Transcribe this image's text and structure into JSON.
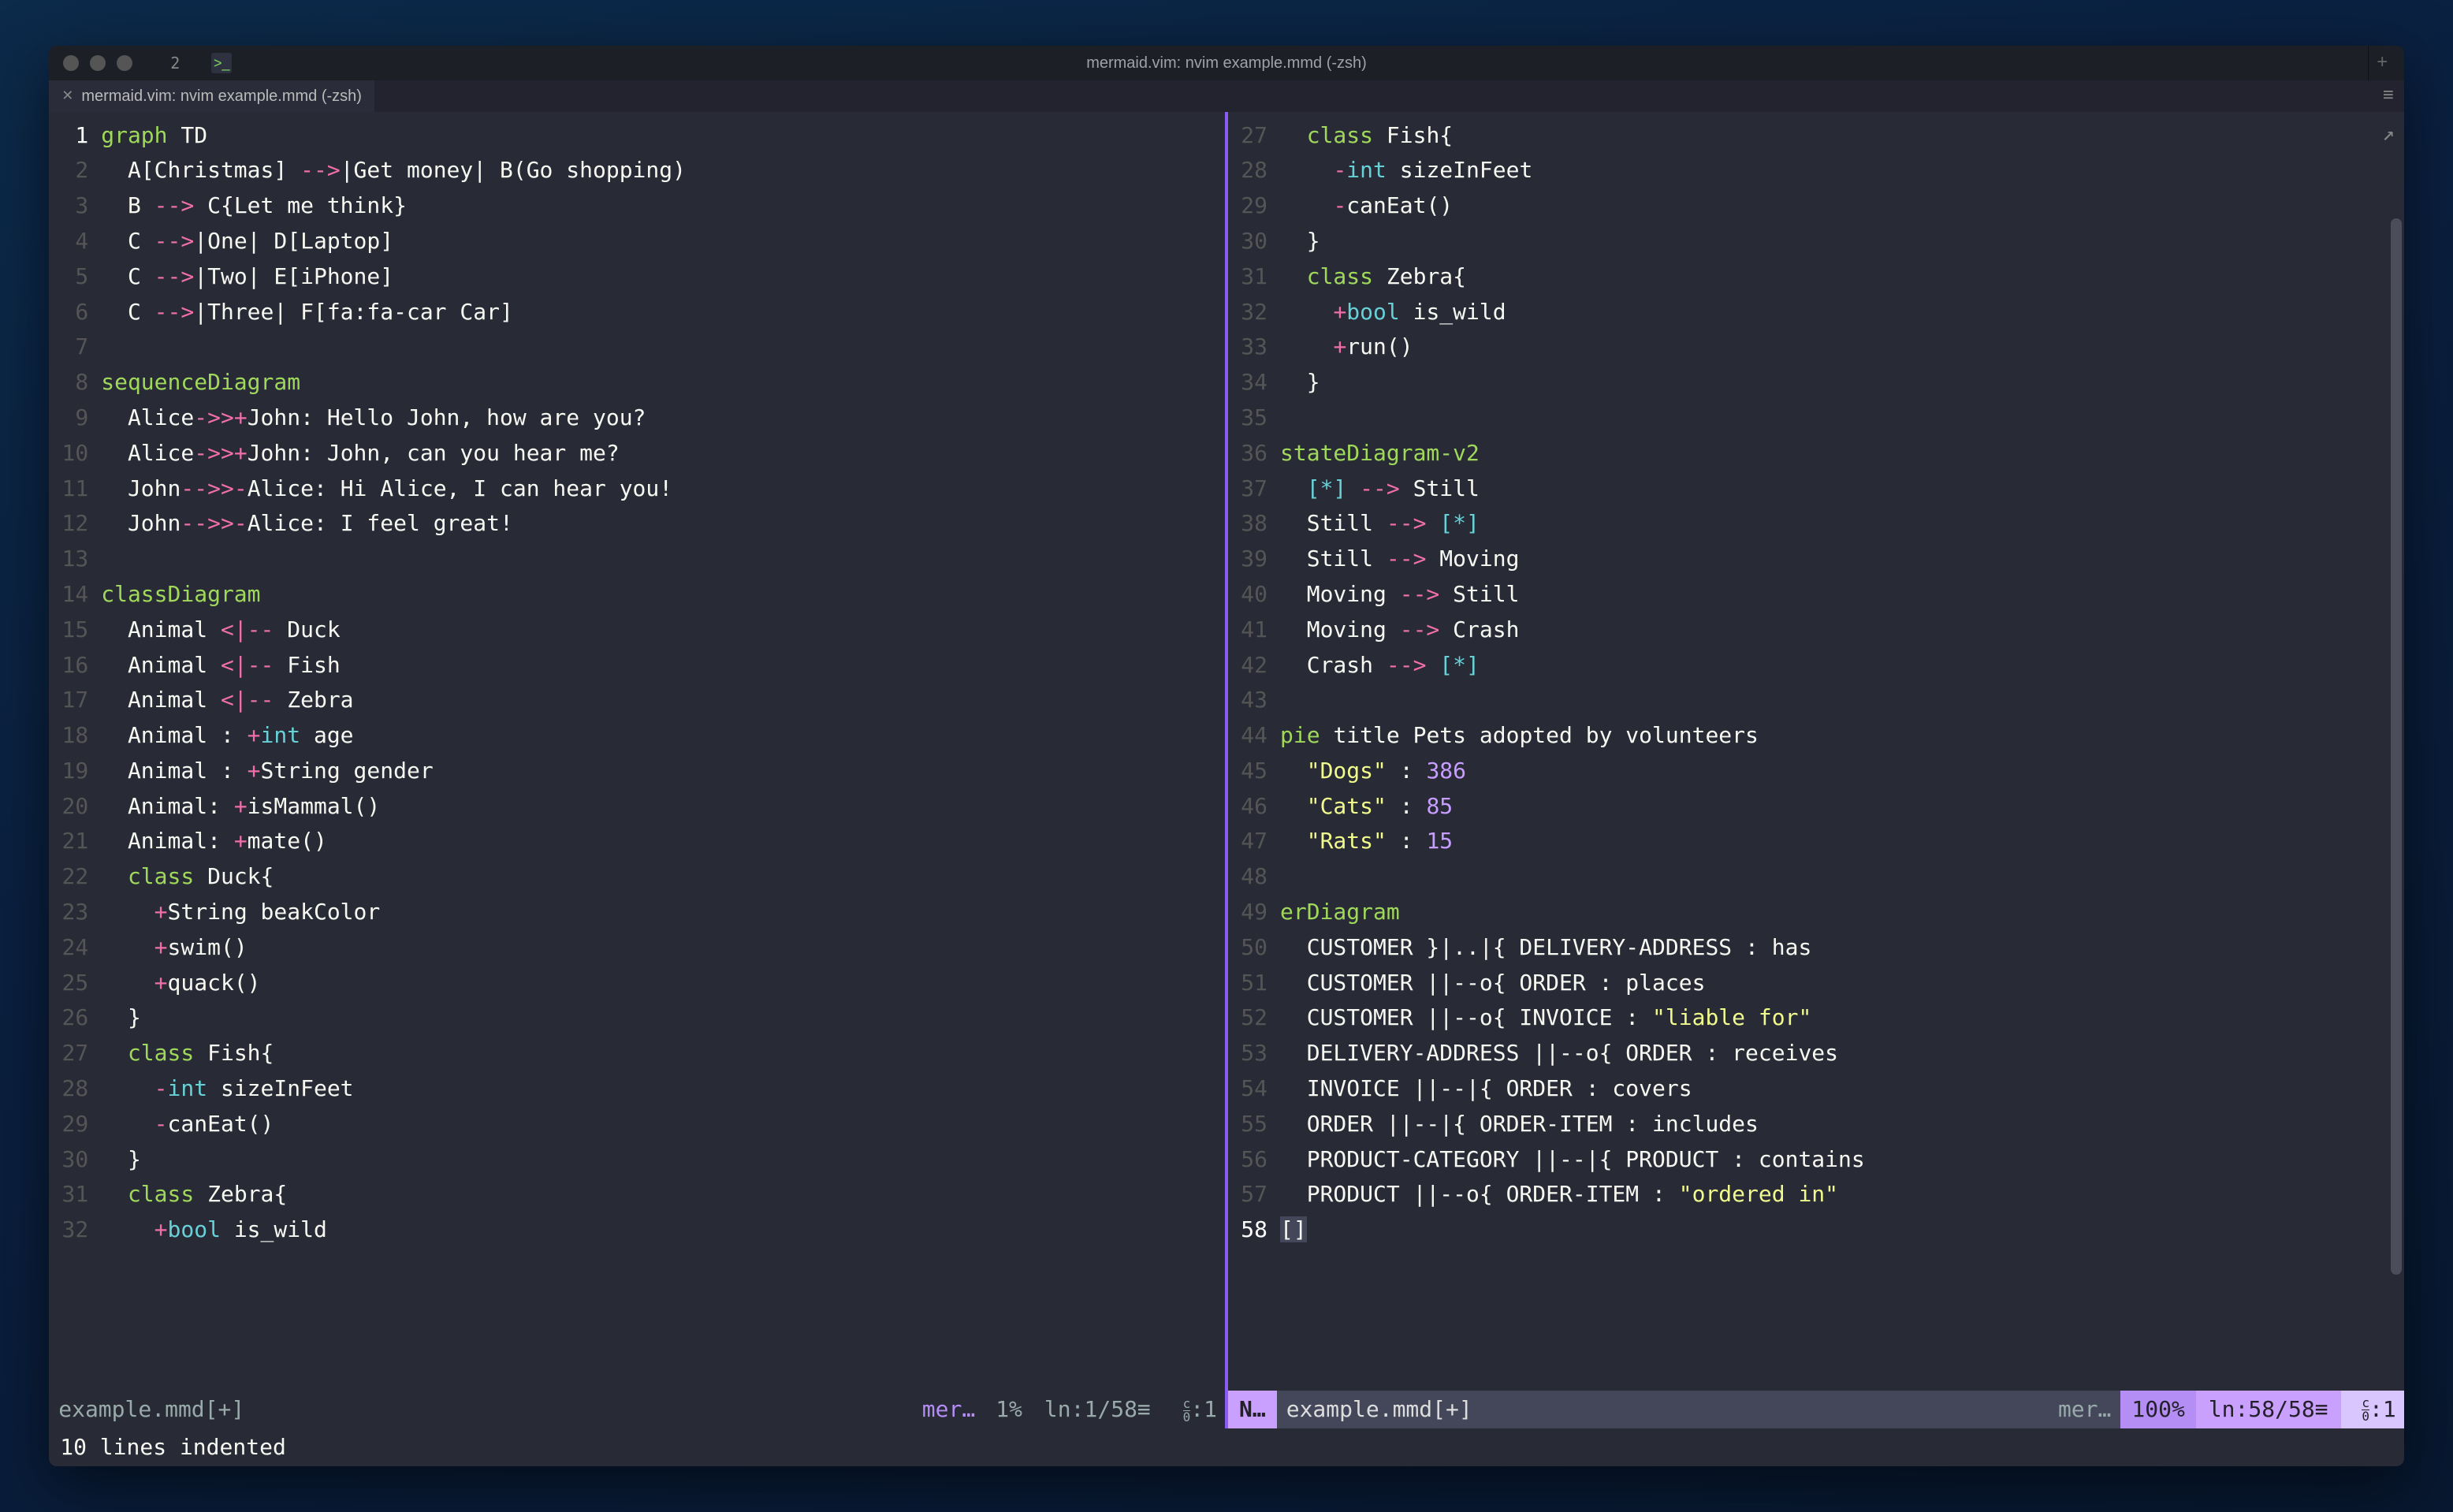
{
  "window": {
    "tab_number": "2",
    "title": "mermaid.vim: nvim example.mmd (-zsh)",
    "plus": "+"
  },
  "apptab": {
    "close": "✕",
    "label": "mermaid.vim: nvim example.mmd (-zsh)",
    "menu": "≡"
  },
  "share_icon": "↗",
  "left_pane": {
    "lines": [
      {
        "n": "1",
        "cur": true,
        "seg": [
          {
            "t": "graph ",
            "c": "kw"
          },
          {
            "t": "TD",
            "c": "white"
          }
        ]
      },
      {
        "n": "2",
        "seg": [
          {
            "t": "  A[Christmas] ",
            "c": "white"
          },
          {
            "t": "-->",
            "c": "op"
          },
          {
            "t": "|Get money| B(Go shopping)",
            "c": "white"
          }
        ]
      },
      {
        "n": "3",
        "seg": [
          {
            "t": "  B ",
            "c": "white"
          },
          {
            "t": "-->",
            "c": "op"
          },
          {
            "t": " C{Let me think}",
            "c": "white"
          }
        ]
      },
      {
        "n": "4",
        "seg": [
          {
            "t": "  C ",
            "c": "white"
          },
          {
            "t": "-->",
            "c": "op"
          },
          {
            "t": "|One| D[Laptop]",
            "c": "white"
          }
        ]
      },
      {
        "n": "5",
        "seg": [
          {
            "t": "  C ",
            "c": "white"
          },
          {
            "t": "-->",
            "c": "op"
          },
          {
            "t": "|Two| E[iPhone]",
            "c": "white"
          }
        ]
      },
      {
        "n": "6",
        "seg": [
          {
            "t": "  C ",
            "c": "white"
          },
          {
            "t": "-->",
            "c": "op"
          },
          {
            "t": "|Three| F[fa:fa-car Car]",
            "c": "white"
          }
        ]
      },
      {
        "n": "7",
        "seg": []
      },
      {
        "n": "8",
        "seg": [
          {
            "t": "sequenceDiagram",
            "c": "kw"
          }
        ]
      },
      {
        "n": "9",
        "seg": [
          {
            "t": "  Alice",
            "c": "white"
          },
          {
            "t": "->>+",
            "c": "op"
          },
          {
            "t": "John: Hello John, how are you?",
            "c": "white"
          }
        ]
      },
      {
        "n": "10",
        "seg": [
          {
            "t": "  Alice",
            "c": "white"
          },
          {
            "t": "->>+",
            "c": "op"
          },
          {
            "t": "John: John, can you hear me?",
            "c": "white"
          }
        ]
      },
      {
        "n": "11",
        "seg": [
          {
            "t": "  John",
            "c": "white"
          },
          {
            "t": "-->>-",
            "c": "op"
          },
          {
            "t": "Alice: Hi Alice, I can hear you!",
            "c": "white"
          }
        ]
      },
      {
        "n": "12",
        "seg": [
          {
            "t": "  John",
            "c": "white"
          },
          {
            "t": "-->>-",
            "c": "op"
          },
          {
            "t": "Alice: I feel great!",
            "c": "white"
          }
        ]
      },
      {
        "n": "13",
        "seg": []
      },
      {
        "n": "14",
        "seg": [
          {
            "t": "classDiagram",
            "c": "kw"
          }
        ]
      },
      {
        "n": "15",
        "seg": [
          {
            "t": "  Animal ",
            "c": "white"
          },
          {
            "t": "<|--",
            "c": "op"
          },
          {
            "t": " Duck",
            "c": "white"
          }
        ]
      },
      {
        "n": "16",
        "seg": [
          {
            "t": "  Animal ",
            "c": "white"
          },
          {
            "t": "<|--",
            "c": "op"
          },
          {
            "t": " Fish",
            "c": "white"
          }
        ]
      },
      {
        "n": "17",
        "seg": [
          {
            "t": "  Animal ",
            "c": "white"
          },
          {
            "t": "<|--",
            "c": "op"
          },
          {
            "t": " Zebra",
            "c": "white"
          }
        ]
      },
      {
        "n": "18",
        "seg": [
          {
            "t": "  Animal : ",
            "c": "white"
          },
          {
            "t": "+",
            "c": "vis"
          },
          {
            "t": "int",
            "c": "ty"
          },
          {
            "t": " age",
            "c": "white"
          }
        ]
      },
      {
        "n": "19",
        "seg": [
          {
            "t": "  Animal : ",
            "c": "white"
          },
          {
            "t": "+",
            "c": "vis"
          },
          {
            "t": "String gender",
            "c": "white"
          }
        ]
      },
      {
        "n": "20",
        "seg": [
          {
            "t": "  Animal: ",
            "c": "white"
          },
          {
            "t": "+",
            "c": "vis"
          },
          {
            "t": "isMammal()",
            "c": "white"
          }
        ]
      },
      {
        "n": "21",
        "seg": [
          {
            "t": "  Animal: ",
            "c": "white"
          },
          {
            "t": "+",
            "c": "vis"
          },
          {
            "t": "mate()",
            "c": "white"
          }
        ]
      },
      {
        "n": "22",
        "seg": [
          {
            "t": "  ",
            "c": "white"
          },
          {
            "t": "class ",
            "c": "kw"
          },
          {
            "t": "Duck{",
            "c": "white"
          }
        ]
      },
      {
        "n": "23",
        "seg": [
          {
            "t": "    ",
            "c": "white"
          },
          {
            "t": "+",
            "c": "vis"
          },
          {
            "t": "String beakColor",
            "c": "white"
          }
        ]
      },
      {
        "n": "24",
        "seg": [
          {
            "t": "    ",
            "c": "white"
          },
          {
            "t": "+",
            "c": "vis"
          },
          {
            "t": "swim()",
            "c": "white"
          }
        ]
      },
      {
        "n": "25",
        "seg": [
          {
            "t": "    ",
            "c": "white"
          },
          {
            "t": "+",
            "c": "vis"
          },
          {
            "t": "quack()",
            "c": "white"
          }
        ]
      },
      {
        "n": "26",
        "seg": [
          {
            "t": "  }",
            "c": "white"
          }
        ]
      },
      {
        "n": "27",
        "seg": [
          {
            "t": "  ",
            "c": "white"
          },
          {
            "t": "class ",
            "c": "kw"
          },
          {
            "t": "Fish{",
            "c": "white"
          }
        ]
      },
      {
        "n": "28",
        "seg": [
          {
            "t": "    ",
            "c": "white"
          },
          {
            "t": "-",
            "c": "vis"
          },
          {
            "t": "int",
            "c": "ty"
          },
          {
            "t": " sizeInFeet",
            "c": "white"
          }
        ]
      },
      {
        "n": "29",
        "seg": [
          {
            "t": "    ",
            "c": "white"
          },
          {
            "t": "-",
            "c": "vis"
          },
          {
            "t": "canEat()",
            "c": "white"
          }
        ]
      },
      {
        "n": "30",
        "seg": [
          {
            "t": "  }",
            "c": "white"
          }
        ]
      },
      {
        "n": "31",
        "seg": [
          {
            "t": "  ",
            "c": "white"
          },
          {
            "t": "class ",
            "c": "kw"
          },
          {
            "t": "Zebra{",
            "c": "white"
          }
        ]
      },
      {
        "n": "32",
        "seg": [
          {
            "t": "    ",
            "c": "white"
          },
          {
            "t": "+",
            "c": "vis"
          },
          {
            "t": "bool",
            "c": "ty"
          },
          {
            "t": " is_wild",
            "c": "white"
          }
        ]
      }
    ],
    "status": {
      "filename": "example.mmd[+]",
      "filetype": "mer…",
      "percent": "1%",
      "lineinfo": "ln:1/58≡",
      "colinfo": ":1"
    }
  },
  "right_pane": {
    "lines": [
      {
        "n": "27",
        "seg": [
          {
            "t": "  ",
            "c": "white"
          },
          {
            "t": "class ",
            "c": "kw"
          },
          {
            "t": "Fish{",
            "c": "white"
          }
        ]
      },
      {
        "n": "28",
        "seg": [
          {
            "t": "    ",
            "c": "white"
          },
          {
            "t": "-",
            "c": "vis"
          },
          {
            "t": "int",
            "c": "ty"
          },
          {
            "t": " sizeInFeet",
            "c": "white"
          }
        ]
      },
      {
        "n": "29",
        "seg": [
          {
            "t": "    ",
            "c": "white"
          },
          {
            "t": "-",
            "c": "vis"
          },
          {
            "t": "canEat()",
            "c": "white"
          }
        ]
      },
      {
        "n": "30",
        "seg": [
          {
            "t": "  }",
            "c": "white"
          }
        ]
      },
      {
        "n": "31",
        "seg": [
          {
            "t": "  ",
            "c": "white"
          },
          {
            "t": "class ",
            "c": "kw"
          },
          {
            "t": "Zebra{",
            "c": "white"
          }
        ]
      },
      {
        "n": "32",
        "seg": [
          {
            "t": "    ",
            "c": "white"
          },
          {
            "t": "+",
            "c": "vis"
          },
          {
            "t": "bool",
            "c": "ty"
          },
          {
            "t": " is_wild",
            "c": "white"
          }
        ]
      },
      {
        "n": "33",
        "seg": [
          {
            "t": "    ",
            "c": "white"
          },
          {
            "t": "+",
            "c": "vis"
          },
          {
            "t": "run()",
            "c": "white"
          }
        ]
      },
      {
        "n": "34",
        "seg": [
          {
            "t": "  }",
            "c": "white"
          }
        ]
      },
      {
        "n": "35",
        "seg": []
      },
      {
        "n": "36",
        "seg": [
          {
            "t": "stateDiagram-v2",
            "c": "kw"
          }
        ]
      },
      {
        "n": "37",
        "seg": [
          {
            "t": "  ",
            "c": "white"
          },
          {
            "t": "[*]",
            "c": "ty"
          },
          {
            "t": " ",
            "c": "white"
          },
          {
            "t": "-->",
            "c": "op"
          },
          {
            "t": " Still",
            "c": "white"
          }
        ]
      },
      {
        "n": "38",
        "seg": [
          {
            "t": "  Still ",
            "c": "white"
          },
          {
            "t": "-->",
            "c": "op"
          },
          {
            "t": " ",
            "c": "white"
          },
          {
            "t": "[*]",
            "c": "ty"
          }
        ]
      },
      {
        "n": "39",
        "seg": [
          {
            "t": "  Still ",
            "c": "white"
          },
          {
            "t": "-->",
            "c": "op"
          },
          {
            "t": " Moving",
            "c": "white"
          }
        ]
      },
      {
        "n": "40",
        "seg": [
          {
            "t": "  Moving ",
            "c": "white"
          },
          {
            "t": "-->",
            "c": "op"
          },
          {
            "t": " Still",
            "c": "white"
          }
        ]
      },
      {
        "n": "41",
        "seg": [
          {
            "t": "  Moving ",
            "c": "white"
          },
          {
            "t": "-->",
            "c": "op"
          },
          {
            "t": " Crash",
            "c": "white"
          }
        ]
      },
      {
        "n": "42",
        "seg": [
          {
            "t": "  Crash ",
            "c": "white"
          },
          {
            "t": "-->",
            "c": "op"
          },
          {
            "t": " ",
            "c": "white"
          },
          {
            "t": "[*]",
            "c": "ty"
          }
        ]
      },
      {
        "n": "43",
        "seg": []
      },
      {
        "n": "44",
        "seg": [
          {
            "t": "pie ",
            "c": "kw"
          },
          {
            "t": "title Pets adopted by volunteers",
            "c": "white"
          }
        ]
      },
      {
        "n": "45",
        "seg": [
          {
            "t": "  ",
            "c": "white"
          },
          {
            "t": "\"Dogs\"",
            "c": "str"
          },
          {
            "t": " : ",
            "c": "white"
          },
          {
            "t": "386",
            "c": "num"
          }
        ]
      },
      {
        "n": "46",
        "seg": [
          {
            "t": "  ",
            "c": "white"
          },
          {
            "t": "\"Cats\"",
            "c": "str"
          },
          {
            "t": " : ",
            "c": "white"
          },
          {
            "t": "85",
            "c": "num"
          }
        ]
      },
      {
        "n": "47",
        "seg": [
          {
            "t": "  ",
            "c": "white"
          },
          {
            "t": "\"Rats\"",
            "c": "str"
          },
          {
            "t": " : ",
            "c": "white"
          },
          {
            "t": "15",
            "c": "num"
          }
        ]
      },
      {
        "n": "48",
        "seg": []
      },
      {
        "n": "49",
        "seg": [
          {
            "t": "erDiagram",
            "c": "kw"
          }
        ]
      },
      {
        "n": "50",
        "seg": [
          {
            "t": "  CUSTOMER }|..|{ DELIVERY-ADDRESS : has",
            "c": "white"
          }
        ]
      },
      {
        "n": "51",
        "seg": [
          {
            "t": "  CUSTOMER ||--o{ ORDER : places",
            "c": "white"
          }
        ]
      },
      {
        "n": "52",
        "seg": [
          {
            "t": "  CUSTOMER ||--o{ INVOICE : ",
            "c": "white"
          },
          {
            "t": "\"liable for\"",
            "c": "str"
          }
        ]
      },
      {
        "n": "53",
        "seg": [
          {
            "t": "  DELIVERY-ADDRESS ||--o{ ORDER : receives",
            "c": "white"
          }
        ]
      },
      {
        "n": "54",
        "seg": [
          {
            "t": "  INVOICE ||--|{ ORDER : covers",
            "c": "white"
          }
        ]
      },
      {
        "n": "55",
        "seg": [
          {
            "t": "  ORDER ||--|{ ORDER-ITEM : includes",
            "c": "white"
          }
        ]
      },
      {
        "n": "56",
        "seg": [
          {
            "t": "  PRODUCT-CATEGORY ||--|{ PRODUCT : contains",
            "c": "white"
          }
        ]
      },
      {
        "n": "57",
        "seg": [
          {
            "t": "  PRODUCT ||--o{ ORDER-ITEM : ",
            "c": "white"
          },
          {
            "t": "\"ordered in\"",
            "c": "str"
          }
        ]
      },
      {
        "n": "58",
        "cur": true,
        "seg": [
          {
            "t": "[]",
            "c": "punc",
            "cursor": true
          }
        ]
      }
    ],
    "status": {
      "mode": "N…",
      "filename": "example.mmd[+]",
      "filetype": "mer…",
      "percent": "100%",
      "lineinfo": "ln:58/58≡",
      "colinfo": ":1"
    }
  },
  "cmdline": "10 lines indented",
  "frac": {
    "top": "c",
    "bot": "0"
  }
}
